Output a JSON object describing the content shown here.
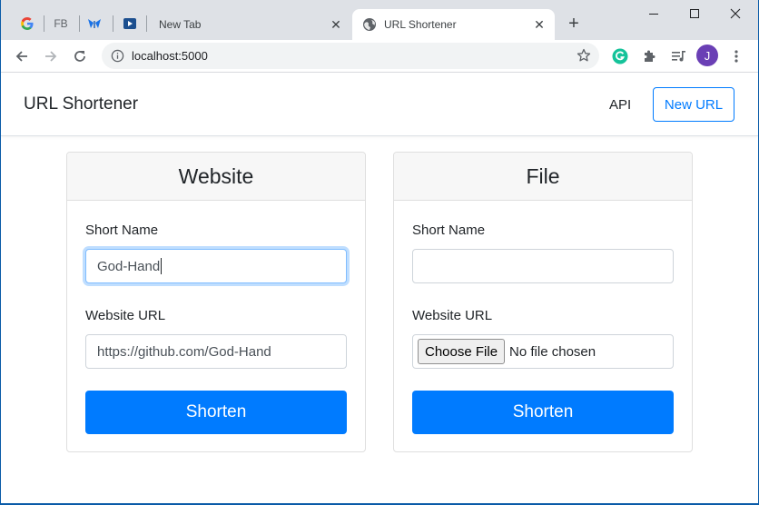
{
  "browser": {
    "pinned_tabs": [
      "G",
      "FB",
      "",
      ""
    ],
    "tabs": [
      {
        "title": "New Tab",
        "close": "✕"
      },
      {
        "title": "URL Shortener",
        "close": "✕"
      }
    ],
    "new_tab": "+",
    "address": "localhost:5000",
    "profile_initial": "J",
    "icons": {
      "back": "arrow-left-icon",
      "forward": "arrow-right-icon",
      "reload": "reload-icon",
      "info": "info-icon",
      "bookmark": "star-icon",
      "grammarly": "grammarly-icon",
      "extensions": "puzzle-icon",
      "media": "playlist-icon",
      "menu": "kebab-menu-icon"
    }
  },
  "navbar": {
    "brand": "URL Shortener",
    "api_link": "API",
    "new_url_button": "New URL"
  },
  "cards": {
    "website": {
      "title": "Website",
      "short_name_label": "Short Name",
      "short_name_value": "God-Hand",
      "url_label": "Website URL",
      "url_value": "https://github.com/God-Hand",
      "submit": "Shorten"
    },
    "file": {
      "title": "File",
      "short_name_label": "Short Name",
      "short_name_value": "",
      "url_label": "Website URL",
      "choose_file": "Choose File",
      "file_status": "No file chosen",
      "submit": "Shorten"
    }
  },
  "colors": {
    "primary": "#007bff",
    "tabstrip": "#dee1e6",
    "profile": "#6a3fb5",
    "grammarly": "#15c39a"
  }
}
